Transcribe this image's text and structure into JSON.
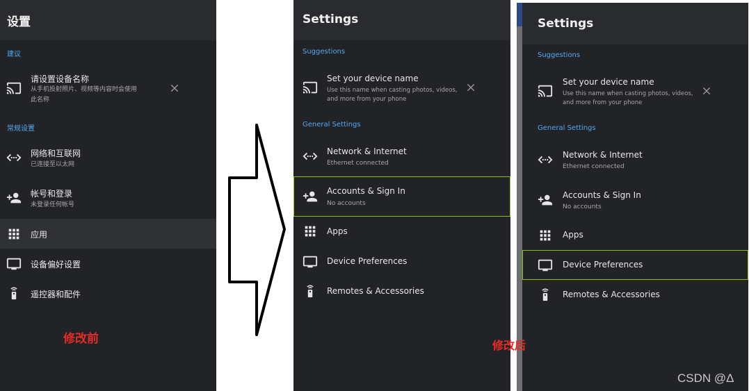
{
  "panels": [
    {
      "header": "设置",
      "sections": [
        "建议",
        "常规设置"
      ],
      "suggestion": {
        "title": "请设置设备名称",
        "subtitle": "从手机投射照片、视频等内容时会使用此名称",
        "subtitle_line1": "从手机投射照片、视频等内容时会使用",
        "subtitle_line2": "此名称"
      },
      "items": [
        {
          "title": "网络和互联网",
          "subtitle": "已连接至以太网"
        },
        {
          "title": "帐号和登录",
          "subtitle": "未登录任何帐号"
        },
        {
          "title": "应用"
        },
        {
          "title": "设备偏好设置"
        },
        {
          "title": "遥控器和配件"
        }
      ]
    },
    {
      "header": "Settings",
      "sections": [
        "Suggestions",
        "General Settings"
      ],
      "suggestion": {
        "title": "Set your device name",
        "subtitle_line1": "Use this name when casting photos, videos,",
        "subtitle_line2": "and more from your phone"
      },
      "items": [
        {
          "title": "Network & Internet",
          "subtitle": "Ethernet connected"
        },
        {
          "title": "Accounts & Sign In",
          "subtitle": "No accounts"
        },
        {
          "title": "Apps"
        },
        {
          "title": "Device Preferences"
        },
        {
          "title": "Remotes & Accessories"
        }
      ]
    },
    {
      "header": "Settings",
      "sections": [
        "Suggestions",
        "General Settings"
      ],
      "suggestion": {
        "title": "Set your device name",
        "subtitle_line1": "Use this name when casting photos, videos,",
        "subtitle_line2": "and more from your phone"
      },
      "items": [
        {
          "title": "Network & Internet",
          "subtitle": "Ethernet connected"
        },
        {
          "title": "Accounts & Sign In",
          "subtitle": "No accounts"
        },
        {
          "title": "Apps"
        },
        {
          "title": "Device Preferences"
        },
        {
          "title": "Remotes & Accessories"
        }
      ]
    }
  ],
  "annotations": {
    "before": "修改前",
    "after": "修改后",
    "watermark": "CSDN @Δ"
  },
  "colors": {
    "panel_bg": "#222327",
    "header_bg": "#2a2b2f",
    "section": "#52a8f3",
    "focus_green": "#8cbe21",
    "annotation_red": "#e52d27"
  }
}
